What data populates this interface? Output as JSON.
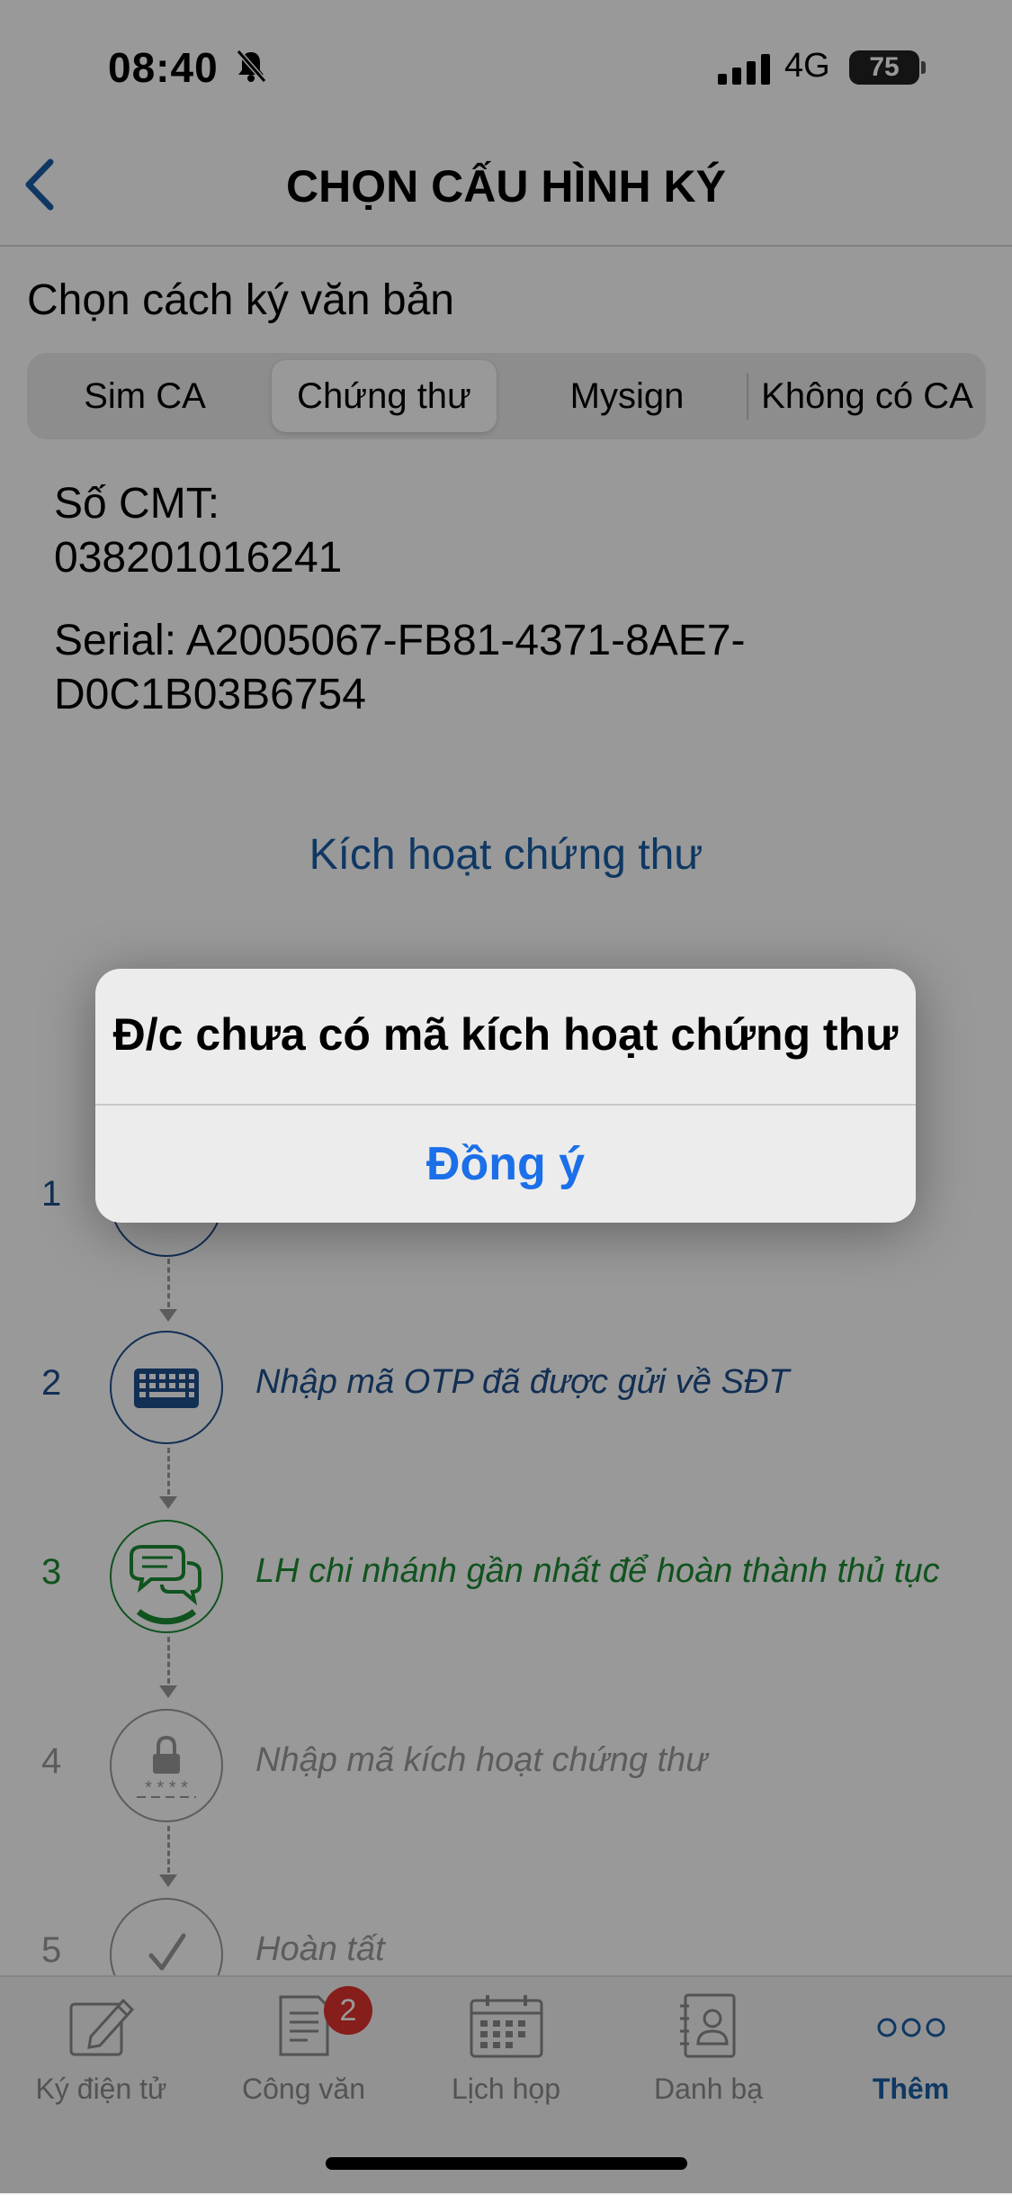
{
  "status_bar": {
    "time": "08:40",
    "network": "4G",
    "battery": "75"
  },
  "nav": {
    "title": "CHỌN CẤU HÌNH KÝ"
  },
  "section_title": "Chọn cách ký văn bản",
  "segments": [
    {
      "label": "Sim CA"
    },
    {
      "label": "Chứng thư"
    },
    {
      "label": "Mysign"
    },
    {
      "label": "Không có CA"
    }
  ],
  "selected_segment": "Chứng thư",
  "info": {
    "cmt_label": "Số CMT:",
    "cmt_value": "038201016241",
    "serial_line1": "Serial: A2005067-FB81-4371-8AE7-",
    "serial_line2": "D0C1B03B6754"
  },
  "activate_link": "Kích hoạt chứng thư",
  "steps": [
    {
      "num": "1",
      "text": "",
      "icon": "download-icon",
      "color": "#1f4f8c"
    },
    {
      "num": "2",
      "text": "Nhập mã OTP đã được gửi về SĐT",
      "icon": "keyboard-icon",
      "color": "#1f4f8c"
    },
    {
      "num": "3",
      "text": "LH chi nhánh gần nhất để hoàn thành thủ tục",
      "icon": "chat-icon",
      "color": "#1c8a32"
    },
    {
      "num": "4",
      "text": "Nhập mã kích hoạt chứng thư",
      "icon": "lock-icon",
      "color": "#9a9a9a"
    },
    {
      "num": "5",
      "text": "Hoàn tất",
      "icon": "check-icon",
      "color": "#9a9a9a"
    }
  ],
  "tab_bar": {
    "items": [
      {
        "label": "Ký điện tử",
        "icon": "pen-icon"
      },
      {
        "label": "Công văn",
        "icon": "document-icon",
        "badge": "2"
      },
      {
        "label": "Lịch họp",
        "icon": "calendar-icon"
      },
      {
        "label": "Danh bạ",
        "icon": "contacts-icon"
      },
      {
        "label": "Thêm",
        "icon": "more-icon"
      }
    ],
    "active": "Thêm",
    "active_color": "#1a5ea6"
  },
  "alert": {
    "title": "Đ/c chưa có mã kích hoạt chứng thư",
    "button": "Đồng ý"
  }
}
